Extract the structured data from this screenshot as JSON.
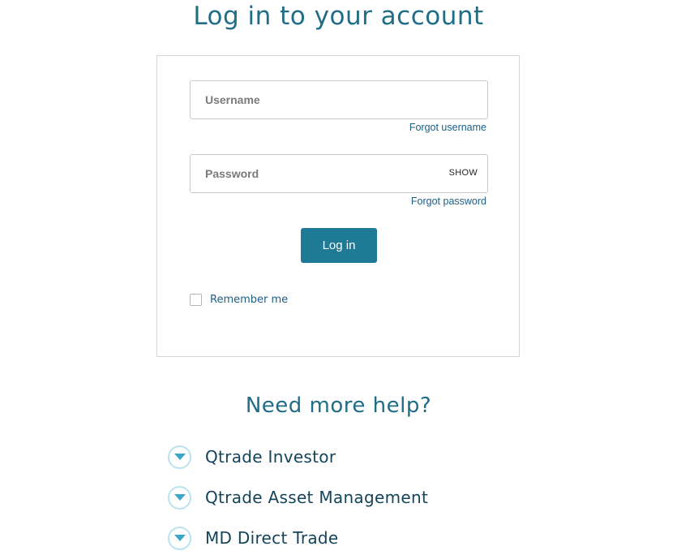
{
  "page": {
    "title": "Log in to your account"
  },
  "login_form": {
    "username_placeholder": "Username",
    "forgot_username": "Forgot username",
    "password_placeholder": "Password",
    "show_toggle": "SHOW",
    "forgot_password": "Forgot password",
    "login_button": "Log in",
    "remember_me": "Remember me",
    "remember_checked": false
  },
  "help": {
    "title": "Need more help?",
    "items": [
      {
        "label": "Qtrade Investor",
        "icon": "chevron-down-circle-icon"
      },
      {
        "label": "Qtrade Asset Management",
        "icon": "chevron-down-circle-icon"
      },
      {
        "label": "MD Direct Trade",
        "icon": "chevron-down-circle-icon"
      }
    ]
  },
  "colors": {
    "heading": "#1f6d86",
    "link": "#1b5e85",
    "button_bg": "#1f7a95",
    "icon_ring": "#b9e3ef",
    "icon_arrow": "#3aa6c9"
  }
}
